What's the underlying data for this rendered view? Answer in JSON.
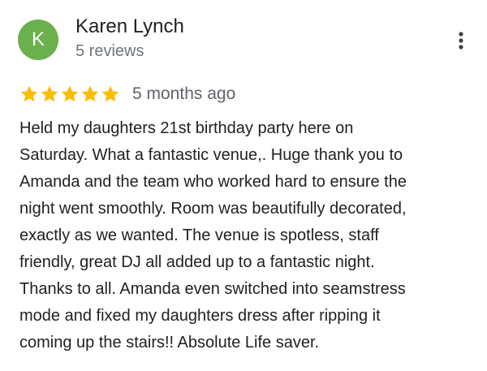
{
  "review": {
    "reviewer": {
      "initial": "K",
      "name": "Karen Lynch",
      "review_count": "5 reviews",
      "avatar_color": "#6ab04c"
    },
    "more_icon": "more-vert-icon",
    "rating": {
      "stars": 5,
      "max_stars": 5,
      "star_icon": "star-icon",
      "star_color": "#fbbc04"
    },
    "date": "5 months ago",
    "text_lines": [
      "Held my daughters 21st birthday party here on",
      "Saturday. What a fantastic venue,. Huge thank you to",
      "Amanda and the team who worked hard to ensure the",
      "night went smoothly. Room was beautifully decorated,",
      "exactly as we wanted. The venue is spotless, staff",
      "friendly, great DJ all added up to a fantastic night.",
      "Thanks to all. Amanda even switched into seamstress",
      "mode and fixed my daughters dress after ripping it",
      "coming up the stairs!! Absolute Life saver."
    ]
  }
}
